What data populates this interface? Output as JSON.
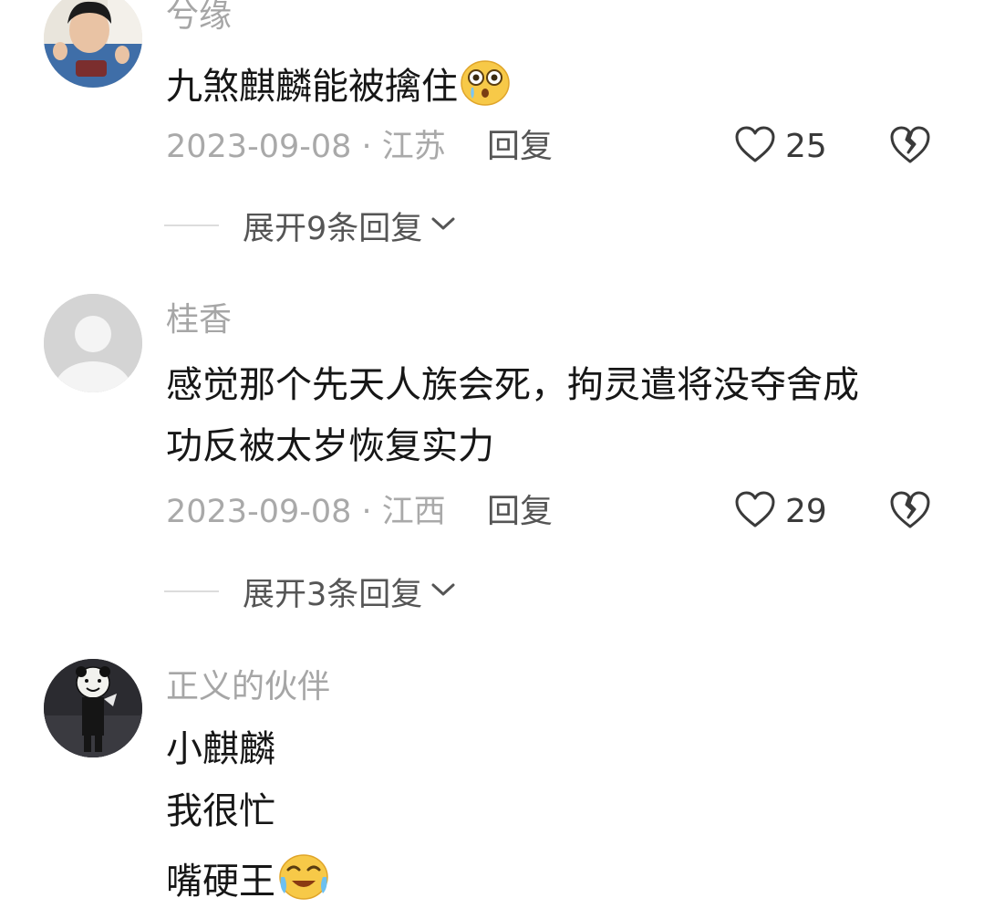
{
  "comments": [
    {
      "username": "兮缘",
      "text": "九煞麒麟能被擒住",
      "emoji": "surprised-crying-face-emoji",
      "date": "2023-09-08 · 江苏",
      "reply_label": "回复",
      "likes": "25",
      "expand_label": "展开9条回复"
    },
    {
      "username": "桂香",
      "text_lines": [
        "感觉那个先天人族会死，拘灵遣将没夺舍成",
        "功反被太岁恢复实力"
      ],
      "date": "2023-09-08 · 江西",
      "reply_label": "回复",
      "likes": "29",
      "expand_label": "展开3条回复"
    },
    {
      "username": "正义的伙伴",
      "text_lines": [
        "小麒麟",
        "我很忙",
        "嘴硬王"
      ],
      "emoji": "tears-of-joy-praying-face-emoji"
    }
  ],
  "icons": {
    "like": "heart-outline-icon",
    "dislike": "broken-heart-icon",
    "expand": "chevron-down-icon"
  },
  "colors": {
    "username": "#a6a6a6",
    "text": "#161616",
    "meta": "#a9a9a9",
    "action": "#555555"
  }
}
